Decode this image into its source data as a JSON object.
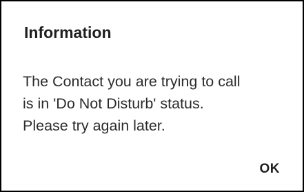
{
  "dialog": {
    "title": "Information",
    "message_lines": [
      "The Contact you are trying to call",
      "is in 'Do Not Disturb' status.",
      "Please try again later."
    ],
    "ok_label": "OK"
  }
}
